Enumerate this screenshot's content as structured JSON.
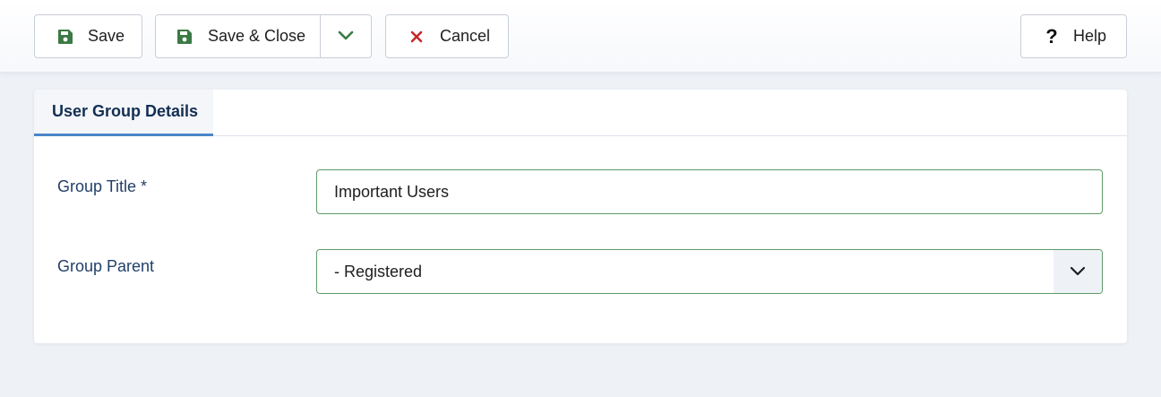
{
  "toolbar": {
    "save_label": "Save",
    "save_close_label": "Save & Close",
    "cancel_label": "Cancel",
    "help_label": "Help",
    "help_glyph": "?"
  },
  "tabs": [
    {
      "label": "User Group Details",
      "active": true
    }
  ],
  "form": {
    "group_title": {
      "label": "Group Title *",
      "value": "Important Users"
    },
    "group_parent": {
      "label": "Group Parent",
      "value": "- Registered"
    }
  },
  "colors": {
    "save_icon": "#3b7a45",
    "cancel_icon": "#c52827",
    "tab_accent": "#4a86c8",
    "input_border": "#5f9a68"
  }
}
